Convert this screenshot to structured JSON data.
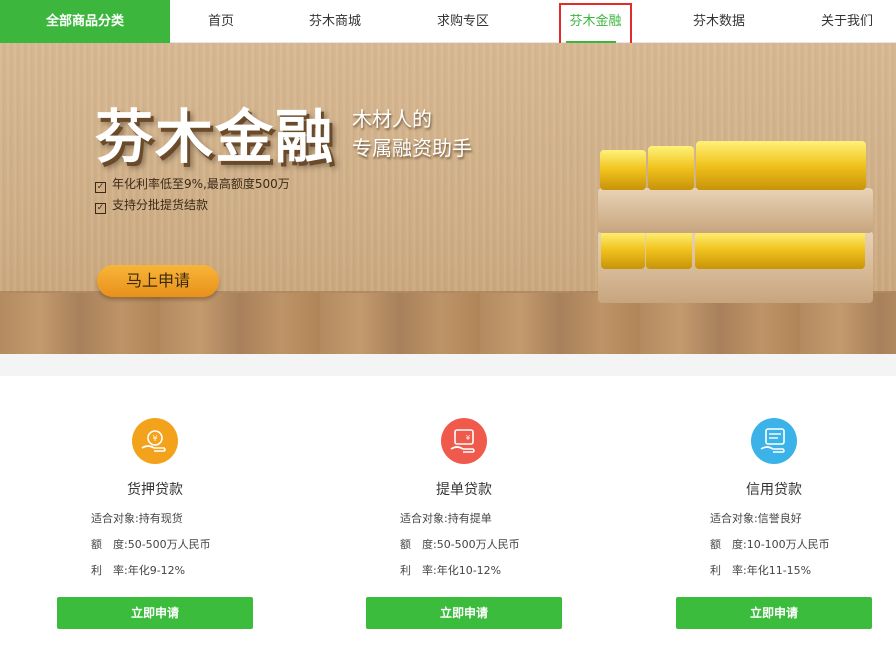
{
  "nav": {
    "category": "全部商品分类",
    "items": [
      "首页",
      "芬木商城",
      "求购专区",
      "芬木金融",
      "芬木数据",
      "关于我们"
    ],
    "active": "芬木金融"
  },
  "banner": {
    "title": "芬木金融",
    "subtitle_line1": "木材人的",
    "subtitle_line2": "专属融资助手",
    "features": [
      "年化利率低至9%,最高额度500万",
      "支持分批提货结款"
    ],
    "button": "马上申请"
  },
  "cards": [
    {
      "title": "货押贷款",
      "icon": "coin-hand-icon",
      "color": "#f3a31b",
      "rows": [
        {
          "label": "适合对象:",
          "value": "持有现货"
        },
        {
          "label": "额　度:",
          "value": "50-500万人民币"
        },
        {
          "label": "利　率:",
          "value": "年化9-12%"
        }
      ],
      "button": "立即申请"
    },
    {
      "title": "提单贷款",
      "icon": "bill-hand-icon",
      "color": "#ef5a4c",
      "rows": [
        {
          "label": "适合对象:",
          "value": "持有提单"
        },
        {
          "label": "额　度:",
          "value": "50-500万人民币"
        },
        {
          "label": "利　率:",
          "value": "年化10-12%"
        }
      ],
      "button": "立即申请"
    },
    {
      "title": "信用贷款",
      "icon": "card-hand-icon",
      "color": "#3bb3e8",
      "rows": [
        {
          "label": "适合对象:",
          "value": "信誉良好"
        },
        {
          "label": "额　度:",
          "value": "10-100万人民币"
        },
        {
          "label": "利　率:",
          "value": "年化11-15%"
        }
      ],
      "button": "立即申请"
    }
  ]
}
